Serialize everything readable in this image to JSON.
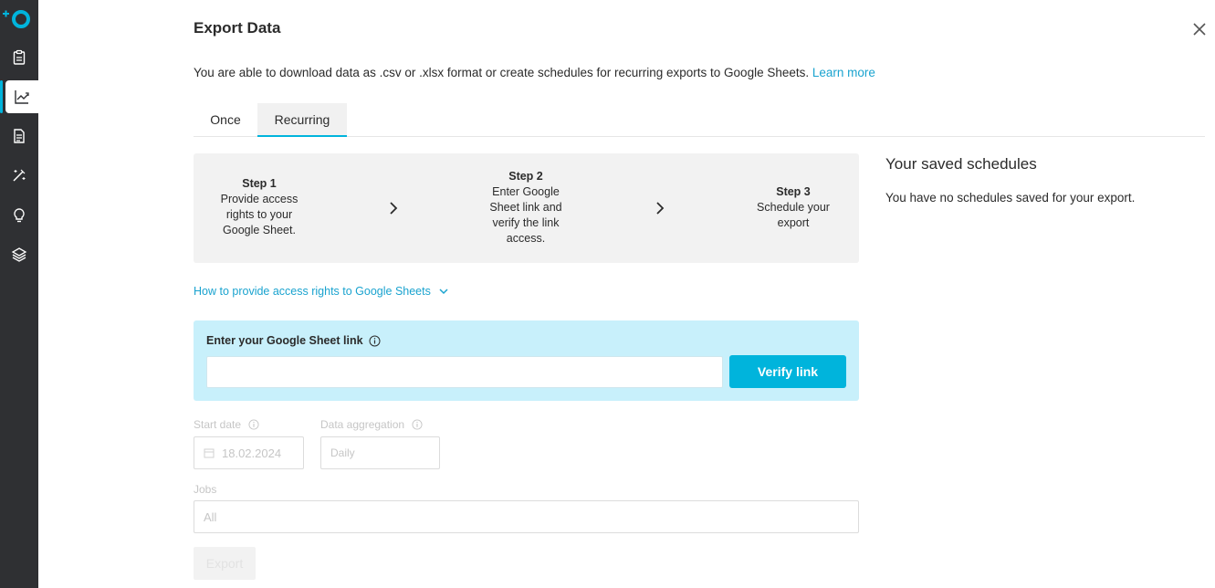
{
  "colors": {
    "accent": "#00b4dc",
    "sidebar": "#2f3033",
    "link": "#1aa3cf",
    "linkbox_bg": "#c8f0fb"
  },
  "sidebar": {
    "items": [
      {
        "icon": "clipboard-icon"
      },
      {
        "icon": "chart-icon",
        "active": true
      },
      {
        "icon": "document-icon"
      },
      {
        "icon": "magic-wand-icon"
      },
      {
        "icon": "lightbulb-icon"
      },
      {
        "icon": "layers-icon"
      }
    ]
  },
  "header": {
    "title": "Export Data",
    "description": "You are able to download data as .csv or .xlsx format or create schedules for recurring exports to Google Sheets.",
    "learn_more": "Learn more"
  },
  "tabs": [
    {
      "label": "Once"
    },
    {
      "label": "Recurring",
      "active": true
    }
  ],
  "steps": [
    {
      "title": "Step 1",
      "text": "Provide access rights to your Google Sheet."
    },
    {
      "title": "Step 2",
      "text": "Enter Google Sheet link and verify the link access."
    },
    {
      "title": "Step 3",
      "text": "Schedule your export"
    }
  ],
  "howto": "How to provide access rights to Google Sheets",
  "sheet_link": {
    "label": "Enter your Google Sheet link",
    "value": "",
    "verify_label": "Verify link"
  },
  "form": {
    "start_date_label": "Start date",
    "start_date_value": "18.02.2024",
    "aggregation_label": "Data aggregation",
    "aggregation_value": "Daily",
    "jobs_label": "Jobs",
    "jobs_value": "All",
    "export_label": "Export"
  },
  "saved": {
    "title": "Your saved schedules",
    "empty_text": "You have no schedules saved for your export."
  }
}
